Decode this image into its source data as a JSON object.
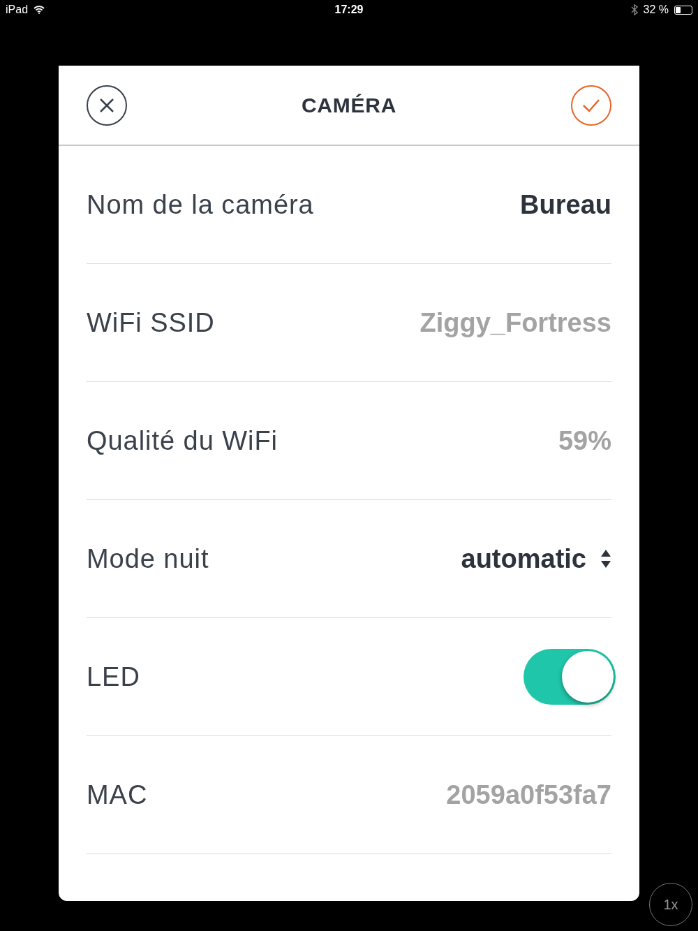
{
  "status_bar": {
    "device": "iPad",
    "time": "17:29",
    "battery": "32 %"
  },
  "header": {
    "title": "CAMÉRA"
  },
  "rows": [
    {
      "kind": "value",
      "label": "Nom de la caméra",
      "value": "Bureau",
      "emphasis": true
    },
    {
      "kind": "value",
      "label": "WiFi SSID",
      "value": "Ziggy_Fortress",
      "emphasis": false
    },
    {
      "kind": "value",
      "label": "Qualité du WiFi",
      "value": "59%",
      "emphasis": false
    },
    {
      "kind": "select",
      "label": "Mode nuit",
      "value": "automatic"
    },
    {
      "kind": "toggle",
      "label": "LED",
      "on": true
    },
    {
      "kind": "value",
      "label": "MAC",
      "value": "2059a0f53fa7",
      "emphasis": false
    }
  ],
  "zoom_button": {
    "label": "1x"
  }
}
